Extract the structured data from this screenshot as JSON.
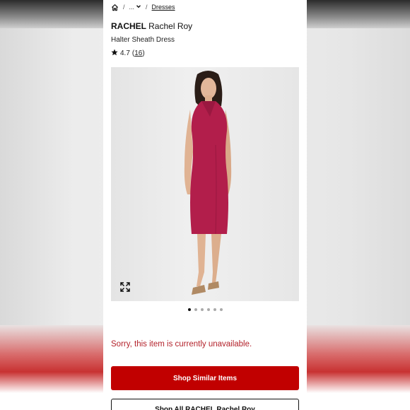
{
  "breadcrumb": {
    "home_icon": "home-icon",
    "separator": "/",
    "ellipsis": "...",
    "chevron_icon": "chevron-down-icon",
    "current": "Dresses"
  },
  "product": {
    "brand_bold": "RACHEL",
    "brand_rest": "Rachel Roy",
    "name": "Halter Sheath Dress",
    "rating_icon": "star-icon",
    "rating_value": "4.7",
    "rating_count": "16"
  },
  "gallery": {
    "image_alt": "Model wearing red halter sheath dress",
    "expand_icon": "expand-icon",
    "dot_count": 6,
    "active_dot": 0
  },
  "status": {
    "unavailable_text": "Sorry, this item is currently unavailable."
  },
  "actions": {
    "shop_similar_label": "Shop Similar Items",
    "shop_all_label": "Shop All RACHEL Rachel Roy"
  },
  "colors": {
    "accent_red": "#c10000",
    "error_text": "#b3222b",
    "dress": "#b21e4b"
  }
}
